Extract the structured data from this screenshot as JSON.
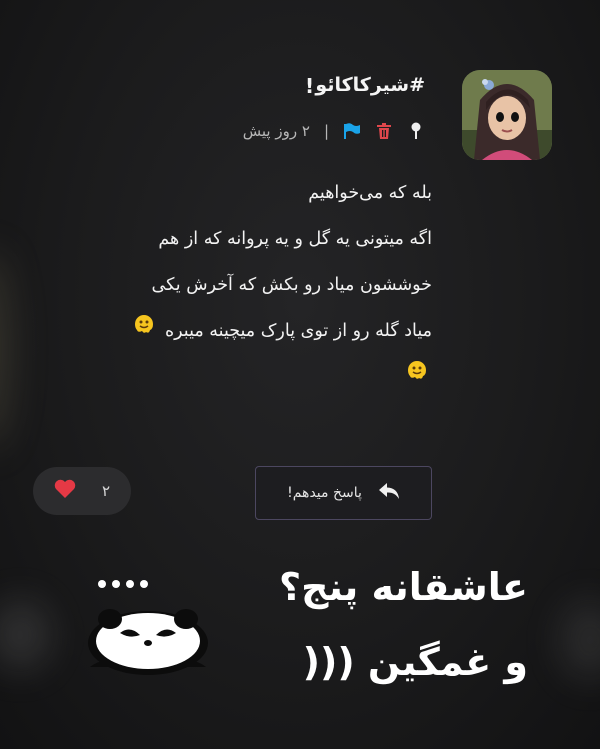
{
  "post": {
    "username": "#شیرکاکائو",
    "badge": "!",
    "time": "۲ روز پیش",
    "lines": [
      "بله که می‌خواهیم",
      "اگه میتونی یه گل و یه پروانه که از هم",
      "خوششون میاد رو بکش که آخرش یکی",
      "میاد گله رو از توی پارک میچینه میبره"
    ]
  },
  "actions": {
    "like_count": "۲",
    "reply_label": "پاسخ میدهم!"
  },
  "overlay": {
    "line1": "عاشقانه پنج؟",
    "line2": "و غمگین ((("
  },
  "colors": {
    "background": "#1a1a1b",
    "trash": "#e0474c",
    "flag": "#1aa3e8",
    "heart": "#e53945"
  },
  "icons": [
    "pin-icon",
    "trash-icon",
    "flag-icon",
    "reply-arrow-icon",
    "heart-icon",
    "melting-face-emoji",
    "panda-sticker"
  ]
}
